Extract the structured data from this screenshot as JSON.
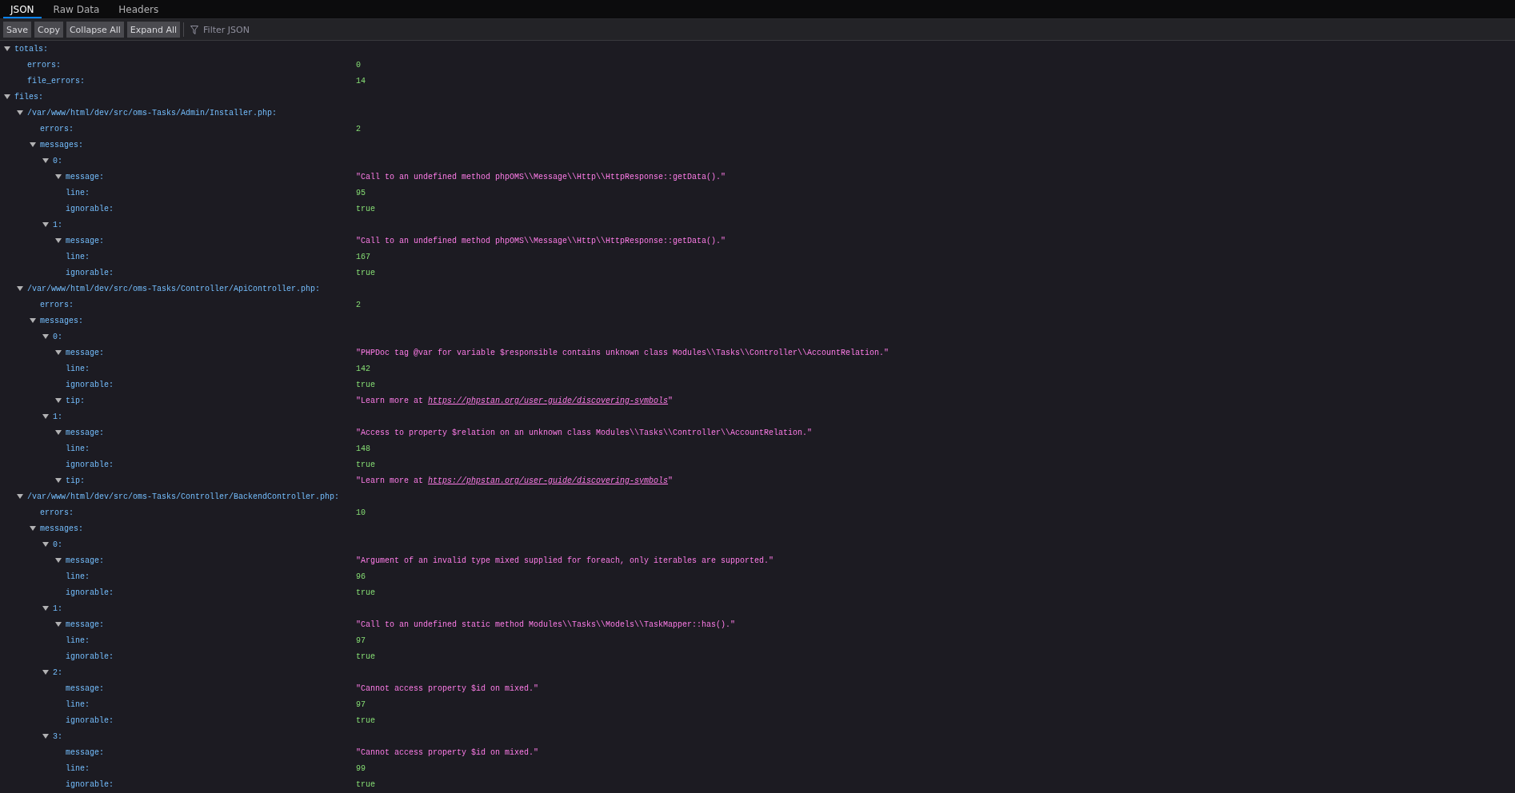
{
  "tabs": [
    {
      "label": "JSON",
      "selected": true
    },
    {
      "label": "Raw Data",
      "selected": false
    },
    {
      "label": "Headers",
      "selected": false
    }
  ],
  "toolbar": {
    "buttons": [
      "Save",
      "Copy",
      "Collapse All",
      "Expand All"
    ],
    "filter": {
      "placeholder": "Filter JSON"
    }
  },
  "tree": [
    {
      "key": "totals:",
      "kind": "expandable",
      "expanded": true,
      "children": [
        {
          "key": "errors:",
          "kind": "leaf",
          "value": {
            "kind": "number",
            "text": "0"
          }
        },
        {
          "key": "file_errors:",
          "kind": "leaf",
          "value": {
            "kind": "number",
            "text": "14"
          }
        }
      ]
    },
    {
      "key": "files:",
      "kind": "expandable",
      "expanded": true,
      "children": [
        {
          "key": "/var/www/html/dev/src/oms-Tasks/Admin/Installer.php:",
          "kind": "expandable",
          "expanded": true,
          "children": [
            {
              "key": "errors:",
              "kind": "leaf",
              "value": {
                "kind": "number",
                "text": "2"
              }
            },
            {
              "key": "messages:",
              "kind": "expandable",
              "expanded": true,
              "children": [
                {
                  "key": "0:",
                  "kind": "expandable",
                  "expanded": true,
                  "children": [
                    {
                      "key": "message:",
                      "kind": "expandable",
                      "expanded": true,
                      "value": {
                        "kind": "string",
                        "text": "\"Call to an undefined method phpOMS\\\\Message\\\\Http\\\\HttpResponse::getData().\""
                      }
                    },
                    {
                      "key": "line:",
                      "kind": "leaf",
                      "value": {
                        "kind": "number",
                        "text": "95"
                      }
                    },
                    {
                      "key": "ignorable:",
                      "kind": "leaf",
                      "value": {
                        "kind": "boolean",
                        "text": "true"
                      }
                    }
                  ]
                },
                {
                  "key": "1:",
                  "kind": "expandable",
                  "expanded": true,
                  "children": [
                    {
                      "key": "message:",
                      "kind": "expandable",
                      "expanded": true,
                      "value": {
                        "kind": "string",
                        "text": "\"Call to an undefined method phpOMS\\\\Message\\\\Http\\\\HttpResponse::getData().\""
                      }
                    },
                    {
                      "key": "line:",
                      "kind": "leaf",
                      "value": {
                        "kind": "number",
                        "text": "167"
                      }
                    },
                    {
                      "key": "ignorable:",
                      "kind": "leaf",
                      "value": {
                        "kind": "boolean",
                        "text": "true"
                      }
                    }
                  ]
                }
              ]
            }
          ]
        },
        {
          "key": "/var/www/html/dev/src/oms-Tasks/Controller/ApiController.php:",
          "kind": "expandable",
          "expanded": true,
          "children": [
            {
              "key": "errors:",
              "kind": "leaf",
              "value": {
                "kind": "number",
                "text": "2"
              }
            },
            {
              "key": "messages:",
              "kind": "expandable",
              "expanded": true,
              "children": [
                {
                  "key": "0:",
                  "kind": "expandable",
                  "expanded": true,
                  "children": [
                    {
                      "key": "message:",
                      "kind": "expandable",
                      "expanded": true,
                      "value": {
                        "kind": "string",
                        "text": "\"PHPDoc tag @var for variable $responsible contains unknown class Modules\\\\Tasks\\\\Controller\\\\AccountRelation.\""
                      }
                    },
                    {
                      "key": "line:",
                      "kind": "leaf",
                      "value": {
                        "kind": "number",
                        "text": "142"
                      }
                    },
                    {
                      "key": "ignorable:",
                      "kind": "leaf",
                      "value": {
                        "kind": "boolean",
                        "text": "true"
                      }
                    },
                    {
                      "key": "tip:",
                      "kind": "expandable",
                      "expanded": true,
                      "value": {
                        "kind": "string",
                        "text": "\"Learn more at ",
                        "link": "https://phpstan.org/user-guide/discovering-symbols",
                        "text_end": "\""
                      }
                    }
                  ]
                },
                {
                  "key": "1:",
                  "kind": "expandable",
                  "expanded": true,
                  "children": [
                    {
                      "key": "message:",
                      "kind": "expandable",
                      "expanded": true,
                      "value": {
                        "kind": "string",
                        "text": "\"Access to property $relation on an unknown class Modules\\\\Tasks\\\\Controller\\\\AccountRelation.\""
                      }
                    },
                    {
                      "key": "line:",
                      "kind": "leaf",
                      "value": {
                        "kind": "number",
                        "text": "148"
                      }
                    },
                    {
                      "key": "ignorable:",
                      "kind": "leaf",
                      "value": {
                        "kind": "boolean",
                        "text": "true"
                      }
                    },
                    {
                      "key": "tip:",
                      "kind": "expandable",
                      "expanded": true,
                      "value": {
                        "kind": "string",
                        "text": "\"Learn more at ",
                        "link": "https://phpstan.org/user-guide/discovering-symbols",
                        "text_end": "\""
                      }
                    }
                  ]
                }
              ]
            }
          ]
        },
        {
          "key": "/var/www/html/dev/src/oms-Tasks/Controller/BackendController.php:",
          "kind": "expandable",
          "expanded": true,
          "children": [
            {
              "key": "errors:",
              "kind": "leaf",
              "value": {
                "kind": "number",
                "text": "10"
              }
            },
            {
              "key": "messages:",
              "kind": "expandable",
              "expanded": true,
              "children": [
                {
                  "key": "0:",
                  "kind": "expandable",
                  "expanded": true,
                  "children": [
                    {
                      "key": "message:",
                      "kind": "expandable",
                      "expanded": true,
                      "value": {
                        "kind": "string",
                        "text": "\"Argument of an invalid type mixed supplied for foreach, only iterables are supported.\""
                      }
                    },
                    {
                      "key": "line:",
                      "kind": "leaf",
                      "value": {
                        "kind": "number",
                        "text": "96"
                      }
                    },
                    {
                      "key": "ignorable:",
                      "kind": "leaf",
                      "value": {
                        "kind": "boolean",
                        "text": "true"
                      }
                    }
                  ]
                },
                {
                  "key": "1:",
                  "kind": "expandable",
                  "expanded": true,
                  "children": [
                    {
                      "key": "message:",
                      "kind": "expandable",
                      "expanded": true,
                      "value": {
                        "kind": "string",
                        "text": "\"Call to an undefined static method Modules\\\\Tasks\\\\Models\\\\TaskMapper::has().\""
                      }
                    },
                    {
                      "key": "line:",
                      "kind": "leaf",
                      "value": {
                        "kind": "number",
                        "text": "97"
                      }
                    },
                    {
                      "key": "ignorable:",
                      "kind": "leaf",
                      "value": {
                        "kind": "boolean",
                        "text": "true"
                      }
                    }
                  ]
                },
                {
                  "key": "2:",
                  "kind": "expandable",
                  "expanded": true,
                  "children": [
                    {
                      "key": "message:",
                      "kind": "leaf",
                      "value": {
                        "kind": "string",
                        "text": "\"Cannot access property $id on mixed.\""
                      }
                    },
                    {
                      "key": "line:",
                      "kind": "leaf",
                      "value": {
                        "kind": "number",
                        "text": "97"
                      }
                    },
                    {
                      "key": "ignorable:",
                      "kind": "leaf",
                      "value": {
                        "kind": "boolean",
                        "text": "true"
                      }
                    }
                  ]
                },
                {
                  "key": "3:",
                  "kind": "expandable",
                  "expanded": true,
                  "children": [
                    {
                      "key": "message:",
                      "kind": "leaf",
                      "value": {
                        "kind": "string",
                        "text": "\"Cannot access property $id on mixed.\""
                      }
                    },
                    {
                      "key": "line:",
                      "kind": "leaf",
                      "value": {
                        "kind": "number",
                        "text": "99"
                      }
                    },
                    {
                      "key": "ignorable:",
                      "kind": "leaf",
                      "value": {
                        "kind": "boolean",
                        "text": "true"
                      }
                    }
                  ]
                }
              ]
            }
          ]
        }
      ]
    }
  ]
}
